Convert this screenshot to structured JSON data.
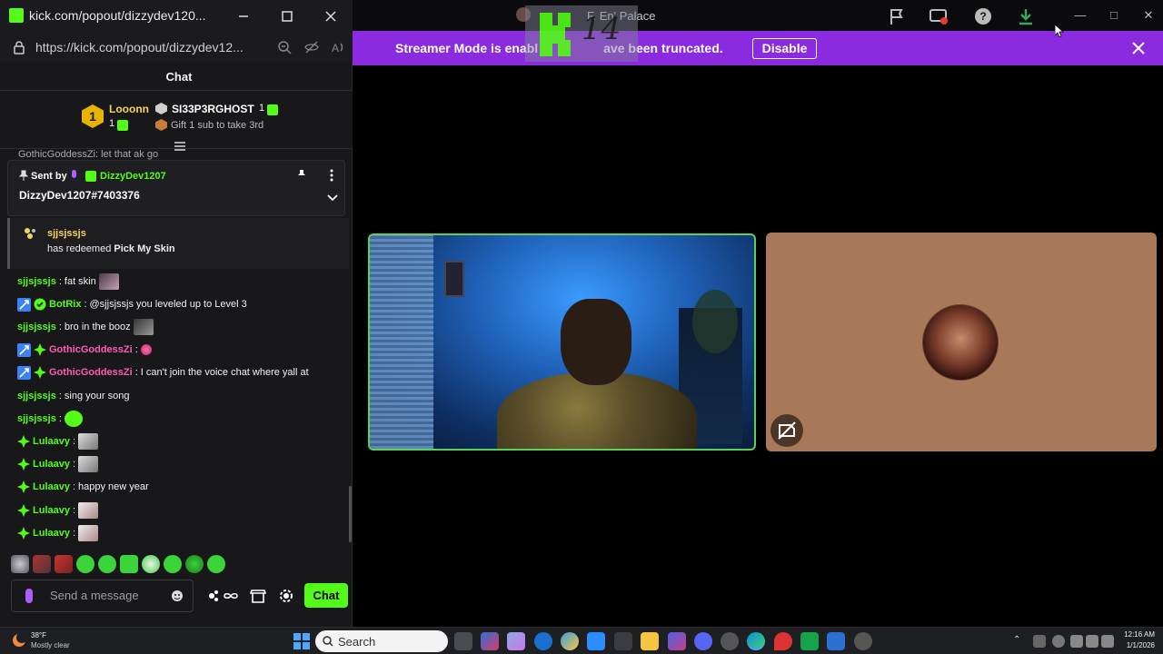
{
  "background_app": {
    "title": "F. En' Palace",
    "streamer_banner": {
      "text_visible": "Streamer Mode is enabl",
      "text_visible_2": "ave been truncated.",
      "disable_label": "Disable"
    },
    "overlay_logo_text": "14",
    "colors": {
      "banner": "#8b2bdf",
      "speaking_border": "#58d15a"
    }
  },
  "popout": {
    "window_title": "kick.com/popout/dizzydev120...",
    "url": "https://kick.com/popout/dizzydev12...",
    "chat_header": "Chat",
    "leaderboard": {
      "first": {
        "rank": "1",
        "name": "Looonn",
        "count": "1"
      },
      "second": {
        "name": "SI33P3RGHOST",
        "count": "1"
      },
      "third_prompt": "Gift 1 sub to take 3rd"
    },
    "cut_off_line": "GothicGoddessZi: let that ak go",
    "pinned": {
      "sent_by_label": "Sent by",
      "user": "DizzyDev1207",
      "message": "DizzyDev1207#7403376"
    },
    "redeem": {
      "user": "sjjsjssjs",
      "text": "has redeemed",
      "reward": "Pick My Skin"
    },
    "messages": [
      {
        "user": "sjjsjssjs",
        "sep": ":",
        "text": "fat skin",
        "color": "#53fc18"
      },
      {
        "user": "BotRix",
        "sep": ":",
        "text": "@sjjsjssjs you leveled up to Level 3",
        "color": "#53fc18"
      },
      {
        "user": "sjjsjssjs",
        "sep": ":",
        "text": "bro in the booz",
        "color": "#53fc18"
      },
      {
        "user": "GothicGoddessZi",
        "sep": ":",
        "text": "",
        "color": "#ff5ab4"
      },
      {
        "user": "GothicGoddessZi",
        "sep": ":",
        "text": "I can't join the voice chat where yall at",
        "color": "#ff5ab4"
      },
      {
        "user": "sjjsjssjs",
        "sep": ":",
        "text": "sing your song",
        "color": "#53fc18"
      },
      {
        "user": "sjjsjssjs",
        "sep": ":",
        "text": "",
        "color": "#53fc18"
      },
      {
        "user": "Lulaavy",
        "sep": ":",
        "text": "",
        "color": "#53fc18"
      },
      {
        "user": "Lulaavy",
        "sep": ":",
        "text": "",
        "color": "#53fc18"
      },
      {
        "user": "Lulaavy",
        "sep": ":",
        "text": "happy new year",
        "color": "#53fc18"
      },
      {
        "user": "Lulaavy",
        "sep": ":",
        "text": "",
        "color": "#53fc18"
      },
      {
        "user": "Lulaavy",
        "sep": ":",
        "text": "",
        "color": "#53fc18"
      }
    ],
    "input_placeholder": "Send a message",
    "chat_button": "Chat",
    "colors": {
      "accent": "#53fc18"
    }
  },
  "taskbar": {
    "weather_temp": "38°F",
    "weather_desc": "Mostly clear",
    "search_label": "Search",
    "time": "12:16 AM",
    "date": "1/1/2026"
  }
}
